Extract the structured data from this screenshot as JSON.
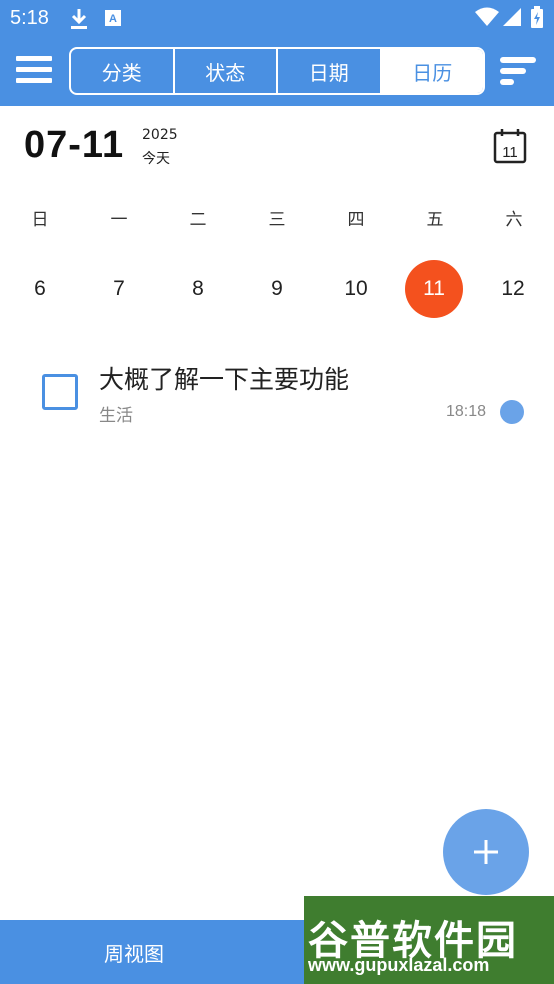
{
  "status_bar": {
    "time": "5:18",
    "icons": [
      "download-icon",
      "keyboard-a-icon",
      "wifi-icon",
      "signal-icon",
      "battery-icon"
    ]
  },
  "app_bar": {
    "tabs": [
      {
        "label": "分类"
      },
      {
        "label": "状态"
      },
      {
        "label": "日期"
      },
      {
        "label": "日历"
      }
    ],
    "selected_tab": "日历"
  },
  "header": {
    "date": "07-11",
    "year": "2025",
    "today_label": "今天",
    "calendar_icon_day": "11"
  },
  "week": {
    "day_names": [
      "日",
      "一",
      "二",
      "三",
      "四",
      "五",
      "六"
    ],
    "dates": [
      "6",
      "7",
      "8",
      "9",
      "10",
      "11",
      "12"
    ],
    "selected_date": "11"
  },
  "tasks": [
    {
      "title": "大概了解一下主要功能",
      "category": "生活",
      "time": "18:18"
    }
  ],
  "bottom_bar": {
    "week_view_label": "周视图"
  },
  "watermark": {
    "title": "谷普软件园",
    "url": "www.gupuxlazal.com"
  },
  "colors": {
    "primary": "#4a90e2",
    "selected_date": "#f4511e",
    "fab": "#6aa3e8"
  }
}
